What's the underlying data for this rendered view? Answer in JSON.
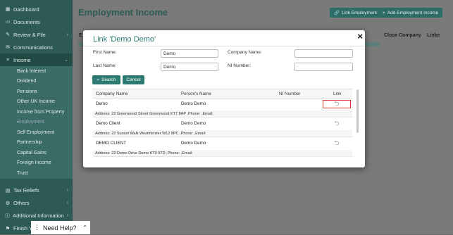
{
  "sidebar": {
    "top_items": [
      {
        "label": "Dashboard",
        "icon": "dashboard-icon",
        "glyph": "▦"
      },
      {
        "label": "Documents",
        "icon": "folder-icon",
        "glyph": "▭"
      },
      {
        "label": "Review & File",
        "icon": "tools-icon",
        "glyph": "✎"
      },
      {
        "label": "Communications",
        "icon": "envelope-icon",
        "glyph": "✉"
      },
      {
        "label": "Income",
        "icon": "list-icon",
        "glyph": "≡"
      }
    ],
    "income_items": [
      "Bank Interest",
      "Dividend",
      "Pensions",
      "Other UK Income",
      "Income from Property",
      "Employment",
      "Self Employment",
      "Partnership",
      "Capital Gains",
      "Foreign Income",
      "Trust"
    ],
    "bottom_items": [
      {
        "label": "Tax Reliefs",
        "icon": "tax-icon",
        "glyph": "▤"
      },
      {
        "label": "Others",
        "icon": "others-icon",
        "glyph": "⚙"
      },
      {
        "label": "Additional Information",
        "icon": "info-icon",
        "glyph": "ⓘ"
      },
      {
        "label": "Finish Y",
        "icon": "finish-icon",
        "glyph": "⚑"
      }
    ]
  },
  "main": {
    "title": "Employment Income",
    "link_employment_label": "Link Employment",
    "add_employment_label": "Add Employment Income",
    "bg_headers": [
      "E",
      "tor",
      "Close Company",
      "Linke"
    ]
  },
  "modal": {
    "title": "Link 'Demo Demo'",
    "close_glyph": "×",
    "first_name_label": "First Name:",
    "first_name_value": "Demo",
    "last_name_label": "Last Name:",
    "last_name_value": "Demo",
    "company_name_label": "Company Name:",
    "company_name_value": "",
    "ni_number_label": "NI Number:",
    "ni_number_value": "",
    "search_label": "Search",
    "cancel_label": "Cancel",
    "table": {
      "headers": [
        "Company Name",
        "Person's Name",
        "NI Number",
        "Link"
      ],
      "rows": [
        {
          "company": "Demo",
          "person": "Demo Demo",
          "ni": "",
          "address": "Address: 22 Greenwood Street Greenwood KT7 8AP ,Phone: ,Email:"
        },
        {
          "company": "Demo Client",
          "person": "Demo Demo",
          "ni": "",
          "address": "Address: 22 Sunset Walk Westminster W12 8PC ,Phone: ,Email:"
        },
        {
          "company": "DEMO CLIENT",
          "person": "Demo Demo",
          "ni": "",
          "address": "Address: 22 Demo Drive Demo KT9 9TD ,Phone: ,Email:"
        }
      ]
    }
  },
  "help": {
    "label": "Need Help?"
  },
  "colors": {
    "sidebar": "#2d5a55",
    "accent": "#2d7a72",
    "highlight": "#d93a2b"
  }
}
